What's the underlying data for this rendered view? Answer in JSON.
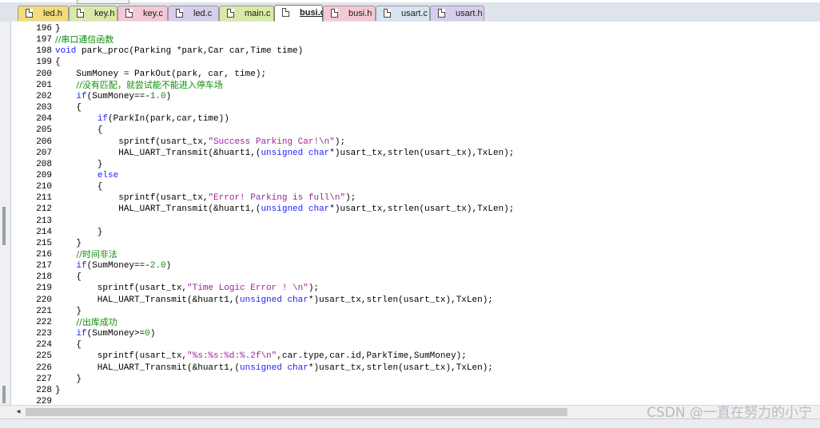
{
  "tabs": [
    {
      "label": "led.h",
      "color": "#f3dc7a",
      "active": false
    },
    {
      "label": "key.h",
      "color": "#d9e9a8",
      "active": false
    },
    {
      "label": "key.c",
      "color": "#f4c8d4",
      "active": false
    },
    {
      "label": "led.c",
      "color": "#d8cdea",
      "active": false
    },
    {
      "label": "main.c",
      "color": "#d9e9a8",
      "active": false
    },
    {
      "label": "busi.c",
      "color": "#f3dc7a",
      "active": true
    },
    {
      "label": "busi.h",
      "color": "#f4c8d4",
      "active": false
    },
    {
      "label": "usart.c",
      "color": "#d8e4f2",
      "active": false
    },
    {
      "label": "usart.h",
      "color": "#d8cdea",
      "active": false
    }
  ],
  "editor": {
    "lines": [
      {
        "n": "196",
        "tokens": [
          {
            "t": "}"
          }
        ]
      },
      {
        "n": "197",
        "tokens": [
          {
            "t": "//串口通信函数",
            "c": "cmt"
          }
        ]
      },
      {
        "n": "198",
        "tokens": [
          {
            "t": "void",
            "c": "kw"
          },
          {
            "t": " park_proc(Parking *park,Car car,Time time)"
          }
        ]
      },
      {
        "n": "199",
        "tokens": [
          {
            "t": "{"
          }
        ]
      },
      {
        "n": "200",
        "tokens": [
          {
            "t": "    SumMoney = ParkOut(park, car, time);"
          }
        ]
      },
      {
        "n": "201",
        "tokens": [
          {
            "t": "    "
          },
          {
            "t": "//没有匹配，就尝试能不能进入停车场",
            "c": "cmt"
          }
        ]
      },
      {
        "n": "202",
        "tokens": [
          {
            "t": "    "
          },
          {
            "t": "if",
            "c": "kw"
          },
          {
            "t": "(SumMoney==-"
          },
          {
            "t": "1.0",
            "c": "num"
          },
          {
            "t": ")"
          }
        ]
      },
      {
        "n": "203",
        "tokens": [
          {
            "t": "    {"
          }
        ]
      },
      {
        "n": "204",
        "tokens": [
          {
            "t": "        "
          },
          {
            "t": "if",
            "c": "kw"
          },
          {
            "t": "(ParkIn(park,car,time))"
          }
        ]
      },
      {
        "n": "205",
        "tokens": [
          {
            "t": "        {"
          }
        ]
      },
      {
        "n": "206",
        "tokens": [
          {
            "t": "            sprintf(usart_tx,"
          },
          {
            "t": "\"Success Parking Car!\\n\"",
            "c": "str"
          },
          {
            "t": ");"
          }
        ]
      },
      {
        "n": "207",
        "tokens": [
          {
            "t": "            HAL_UART_Transmit(&huart1,("
          },
          {
            "t": "unsigned char",
            "c": "kw"
          },
          {
            "t": "*)usart_tx,strlen(usart_tx),TxLen);"
          }
        ]
      },
      {
        "n": "208",
        "tokens": [
          {
            "t": "        }"
          }
        ]
      },
      {
        "n": "209",
        "tokens": [
          {
            "t": "        "
          },
          {
            "t": "else",
            "c": "kw"
          }
        ]
      },
      {
        "n": "210",
        "tokens": [
          {
            "t": "        {"
          }
        ]
      },
      {
        "n": "211",
        "tokens": [
          {
            "t": "            sprintf(usart_tx,"
          },
          {
            "t": "\"Error! Parking is full\\n\"",
            "c": "str"
          },
          {
            "t": ");"
          }
        ]
      },
      {
        "n": "212",
        "tokens": [
          {
            "t": "            HAL_UART_Transmit(&huart1,("
          },
          {
            "t": "unsigned char",
            "c": "kw"
          },
          {
            "t": "*)usart_tx,strlen(usart_tx),TxLen);"
          }
        ]
      },
      {
        "n": "213",
        "tokens": [
          {
            "t": ""
          }
        ]
      },
      {
        "n": "214",
        "tokens": [
          {
            "t": "        }"
          }
        ]
      },
      {
        "n": "215",
        "tokens": [
          {
            "t": "    }"
          }
        ]
      },
      {
        "n": "216",
        "tokens": [
          {
            "t": "    "
          },
          {
            "t": "//时间非法",
            "c": "cmt"
          }
        ]
      },
      {
        "n": "217",
        "tokens": [
          {
            "t": "    "
          },
          {
            "t": "if",
            "c": "kw"
          },
          {
            "t": "(SumMoney==-"
          },
          {
            "t": "2.0",
            "c": "num"
          },
          {
            "t": ")"
          }
        ]
      },
      {
        "n": "218",
        "tokens": [
          {
            "t": "    {"
          }
        ]
      },
      {
        "n": "219",
        "tokens": [
          {
            "t": "        sprintf(usart_tx,"
          },
          {
            "t": "\"Time Logic Error ! \\n\"",
            "c": "str"
          },
          {
            "t": ");"
          }
        ]
      },
      {
        "n": "220",
        "tokens": [
          {
            "t": "        HAL_UART_Transmit(&huart1,("
          },
          {
            "t": "unsigned char",
            "c": "kw"
          },
          {
            "t": "*)usart_tx,strlen(usart_tx),TxLen);"
          }
        ]
      },
      {
        "n": "221",
        "tokens": [
          {
            "t": "    }"
          }
        ]
      },
      {
        "n": "222",
        "tokens": [
          {
            "t": "    "
          },
          {
            "t": "//出库成功",
            "c": "cmt"
          }
        ]
      },
      {
        "n": "223",
        "tokens": [
          {
            "t": "    "
          },
          {
            "t": "if",
            "c": "kw"
          },
          {
            "t": "(SumMoney>="
          },
          {
            "t": "0",
            "c": "num"
          },
          {
            "t": ")"
          }
        ]
      },
      {
        "n": "224",
        "tokens": [
          {
            "t": "    {"
          }
        ]
      },
      {
        "n": "225",
        "tokens": [
          {
            "t": "        sprintf(usart_tx,"
          },
          {
            "t": "\"%s:%s:%d:%.2f\\n\"",
            "c": "str"
          },
          {
            "t": ",car.type,car.id,ParkTime,SumMoney);"
          }
        ]
      },
      {
        "n": "226",
        "tokens": [
          {
            "t": "        HAL_UART_Transmit(&huart1,("
          },
          {
            "t": "unsigned char",
            "c": "kw"
          },
          {
            "t": "*)usart_tx,strlen(usart_tx),TxLen);"
          }
        ]
      },
      {
        "n": "227",
        "tokens": [
          {
            "t": "    }"
          }
        ]
      },
      {
        "n": "228",
        "tokens": [
          {
            "t": "}"
          }
        ]
      },
      {
        "n": "229",
        "tokens": [
          {
            "t": ""
          }
        ]
      }
    ]
  },
  "watermark": "CSDN @一直在努力的小宁"
}
